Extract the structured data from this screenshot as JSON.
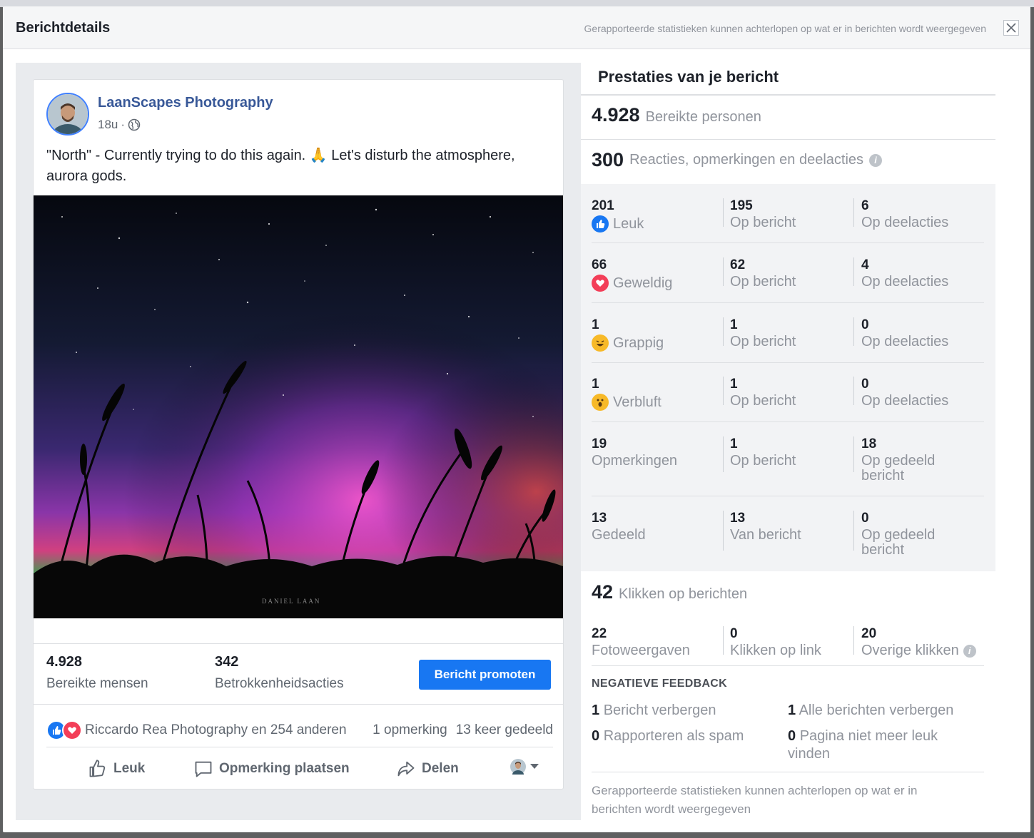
{
  "dialog": {
    "title": "Berichtdetails",
    "note": "Gerapporteerde statistieken kunnen achterlopen op wat er in berichten wordt weergegeven",
    "close_icon": "close-icon"
  },
  "post": {
    "page_name": "LaanScapes Photography",
    "time": "18u",
    "privacy_icon": "globe-icon",
    "text": "\"North\" - Currently trying to do this again. 🙏 Let's disturb the atmosphere, aurora gods.",
    "image_watermark": "DANIEL LAAN",
    "reach_num": "4.928",
    "reach_label": "Bereikte mensen",
    "engagement_num": "342",
    "engagement_label": "Betrokkenheidsacties",
    "promote_label": "Bericht promoten",
    "reactions_text": "Riccardo Rea Photography en 254 anderen",
    "comments_text": "1 opmerking",
    "shares_text": "13 keer gedeeld",
    "actions": {
      "like": "Leuk",
      "comment": "Opmerking plaatsen",
      "share": "Delen"
    }
  },
  "performance": {
    "title": "Prestaties van je bericht",
    "reach": {
      "num": "4.928",
      "label": "Bereikte personen"
    },
    "engagement": {
      "num": "300",
      "label": "Reacties, opmerkingen en deelacties"
    },
    "rows": [
      {
        "total": "201",
        "label": "Leuk",
        "icon": "like-icon",
        "mid_num": "195",
        "mid_label": "Op bericht",
        "right_num": "6",
        "right_label": "Op deelacties"
      },
      {
        "total": "66",
        "label": "Geweldig",
        "icon": "love-icon",
        "mid_num": "62",
        "mid_label": "Op bericht",
        "right_num": "4",
        "right_label": "Op deelacties"
      },
      {
        "total": "1",
        "label": "Grappig",
        "icon": "haha-icon",
        "mid_num": "1",
        "mid_label": "Op bericht",
        "right_num": "0",
        "right_label": "Op deelacties"
      },
      {
        "total": "1",
        "label": "Verbluft",
        "icon": "wow-icon",
        "mid_num": "1",
        "mid_label": "Op bericht",
        "right_num": "0",
        "right_label": "Op deelacties"
      },
      {
        "total": "19",
        "label": "Opmerkingen",
        "icon": "",
        "mid_num": "1",
        "mid_label": "Op bericht",
        "right_num": "18",
        "right_label": "Op gedeeld bericht"
      },
      {
        "total": "13",
        "label": "Gedeeld",
        "icon": "",
        "mid_num": "13",
        "mid_label": "Van bericht",
        "right_num": "0",
        "right_label": "Op gedeeld bericht"
      }
    ],
    "clicks": {
      "num": "42",
      "label": "Klikken op berichten"
    },
    "click_rows": [
      {
        "num": "22",
        "label": "Fotoweergaven"
      },
      {
        "num": "0",
        "label": "Klikken op link"
      },
      {
        "num": "20",
        "label": "Overige klikken"
      }
    ],
    "negative_title": "NEGATIEVE FEEDBACK",
    "negative": [
      {
        "num": "1",
        "label": "Bericht verbergen"
      },
      {
        "num": "1",
        "label": "Alle berichten verbergen"
      },
      {
        "num": "0",
        "label": "Rapporteren als spam"
      },
      {
        "num": "0",
        "label": "Pagina niet meer leuk vinden"
      }
    ],
    "footer": "Gerapporteerde statistieken kunnen achterlopen op wat er in berichten wordt weergegeven"
  },
  "colors": {
    "link": "#385898",
    "promote": "#1877f2",
    "muted": "#90949c"
  }
}
